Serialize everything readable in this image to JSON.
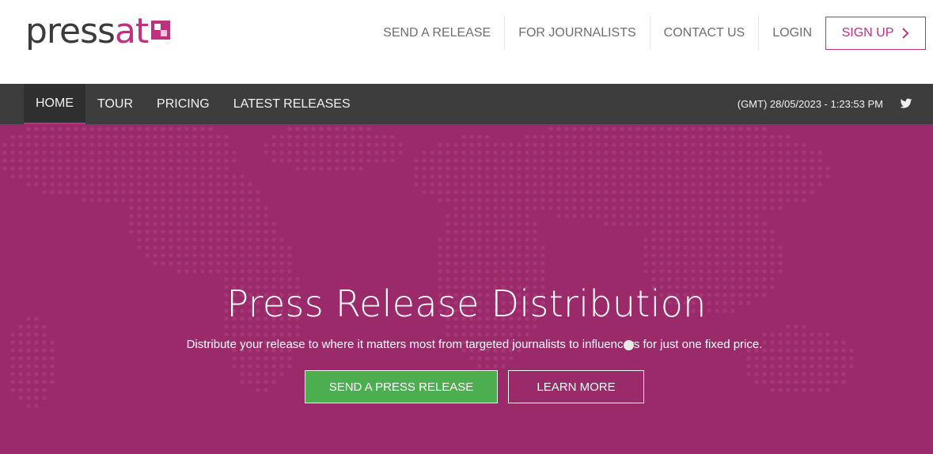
{
  "brand": {
    "logo_part1": "press",
    "logo_part2": "at",
    "primary_color": "#c0307f",
    "hero_color": "#9b2a6b",
    "nav_color": "#3d3d3d",
    "button_green": "#4cae4f"
  },
  "top_nav": {
    "items": [
      {
        "label": "SEND A RELEASE"
      },
      {
        "label": "FOR JOURNALISTS"
      },
      {
        "label": "CONTACT US"
      },
      {
        "label": "LOGIN"
      }
    ],
    "signup_label": "SIGN UP",
    "signup_icon": "chevron-right-icon"
  },
  "main_nav": {
    "items": [
      {
        "label": "HOME",
        "active": true
      },
      {
        "label": "TOUR",
        "active": false
      },
      {
        "label": "PRICING",
        "active": false
      },
      {
        "label": "LATEST RELEASES",
        "active": false
      }
    ],
    "clock": "(GMT) 28/05/2023 - 1:23:53 PM",
    "social_icon": "twitter-icon"
  },
  "hero": {
    "title": "Press Release Distribution",
    "subtitle": "Distribute your release to where it matters most from targeted journalists to influencers for just one fixed price.",
    "primary_button": "SEND A PRESS RELEASE",
    "secondary_button": "LEARN MORE",
    "background_icon": "world-map-dots"
  }
}
